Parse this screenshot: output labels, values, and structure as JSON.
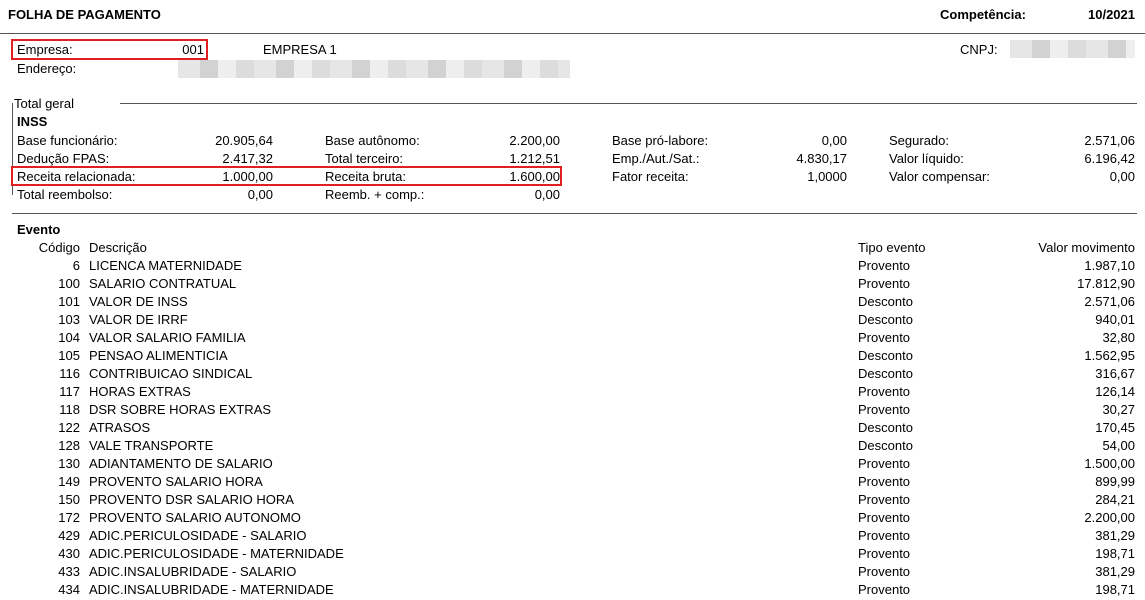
{
  "header": {
    "title": "FOLHA DE PAGAMENTO",
    "competencia_label": "Competência:",
    "competencia_value": "10/2021"
  },
  "company": {
    "empresa_label": "Empresa:",
    "empresa_code": "001",
    "empresa_name": "EMPRESA 1",
    "endereco_label": "Endereço:",
    "cnpj_label": "CNPJ:"
  },
  "total_geral": {
    "section_label": "Total geral",
    "inss_label": "INSS",
    "col1": [
      {
        "label": "Base funcionário:",
        "value": "20.905,64"
      },
      {
        "label": "Dedução FPAS:",
        "value": "2.417,32"
      },
      {
        "label": "Receita relacionada:",
        "value": "1.000,00"
      },
      {
        "label": "Total reembolso:",
        "value": "0,00"
      }
    ],
    "col2": [
      {
        "label": "Base autônomo:",
        "value": "2.200,00"
      },
      {
        "label": "Total terceiro:",
        "value": "1.212,51"
      },
      {
        "label": "Receita bruta:",
        "value": "1.600,00"
      },
      {
        "label": "Reemb. + comp.:",
        "value": "0,00"
      }
    ],
    "col3": [
      {
        "label": "Base pró-labore:",
        "value": "0,00"
      },
      {
        "label": "Emp./Aut./Sat.:",
        "value": "4.830,17"
      },
      {
        "label": "Fator receita:",
        "value": "1,0000"
      }
    ],
    "col4": [
      {
        "label": "Segurado:",
        "value": "2.571,06"
      },
      {
        "label": "Valor líquido:",
        "value": "6.196,42"
      },
      {
        "label": "Valor compensar:",
        "value": "0,00"
      }
    ]
  },
  "evento": {
    "section_label": "Evento",
    "headers": {
      "codigo": "Código",
      "descricao": "Descrição",
      "tipo": "Tipo evento",
      "valor": "Valor movimento"
    },
    "rows": [
      {
        "codigo": "6",
        "descricao": "LICENCA MATERNIDADE",
        "tipo": "Provento",
        "valor": "1.987,10"
      },
      {
        "codigo": "100",
        "descricao": "SALARIO CONTRATUAL",
        "tipo": "Provento",
        "valor": "17.812,90"
      },
      {
        "codigo": "101",
        "descricao": "VALOR DE INSS",
        "tipo": "Desconto",
        "valor": "2.571,06"
      },
      {
        "codigo": "103",
        "descricao": "VALOR DE IRRF",
        "tipo": "Desconto",
        "valor": "940,01"
      },
      {
        "codigo": "104",
        "descricao": "VALOR SALARIO FAMILIA",
        "tipo": "Provento",
        "valor": "32,80"
      },
      {
        "codigo": "105",
        "descricao": "PENSAO ALIMENTICIA",
        "tipo": "Desconto",
        "valor": "1.562,95"
      },
      {
        "codigo": "116",
        "descricao": "CONTRIBUICAO SINDICAL",
        "tipo": "Desconto",
        "valor": "316,67"
      },
      {
        "codigo": "117",
        "descricao": "HORAS EXTRAS",
        "tipo": "Provento",
        "valor": "126,14"
      },
      {
        "codigo": "118",
        "descricao": "DSR SOBRE HORAS EXTRAS",
        "tipo": "Provento",
        "valor": "30,27"
      },
      {
        "codigo": "122",
        "descricao": "ATRASOS",
        "tipo": "Desconto",
        "valor": "170,45"
      },
      {
        "codigo": "128",
        "descricao": "VALE TRANSPORTE",
        "tipo": "Desconto",
        "valor": "54,00"
      },
      {
        "codigo": "130",
        "descricao": "ADIANTAMENTO DE SALARIO",
        "tipo": "Provento",
        "valor": "1.500,00"
      },
      {
        "codigo": "149",
        "descricao": "PROVENTO SALARIO HORA",
        "tipo": "Provento",
        "valor": "899,99"
      },
      {
        "codigo": "150",
        "descricao": "PROVENTO DSR SALARIO HORA",
        "tipo": "Provento",
        "valor": "284,21"
      },
      {
        "codigo": "172",
        "descricao": "PROVENTO SALARIO AUTONOMO",
        "tipo": "Provento",
        "valor": "2.200,00"
      },
      {
        "codigo": "429",
        "descricao": "ADIC.PERICULOSIDADE - SALARIO",
        "tipo": "Provento",
        "valor": "381,29"
      },
      {
        "codigo": "430",
        "descricao": "ADIC.PERICULOSIDADE - MATERNIDADE",
        "tipo": "Provento",
        "valor": "198,71"
      },
      {
        "codigo": "433",
        "descricao": "ADIC.INSALUBRIDADE - SALARIO",
        "tipo": "Provento",
        "valor": "381,29"
      },
      {
        "codigo": "434",
        "descricao": "ADIC.INSALUBRIDADE - MATERNIDADE",
        "tipo": "Provento",
        "valor": "198,71"
      }
    ]
  },
  "colors": {
    "highlight": "#e02020",
    "rule": "#555555"
  }
}
